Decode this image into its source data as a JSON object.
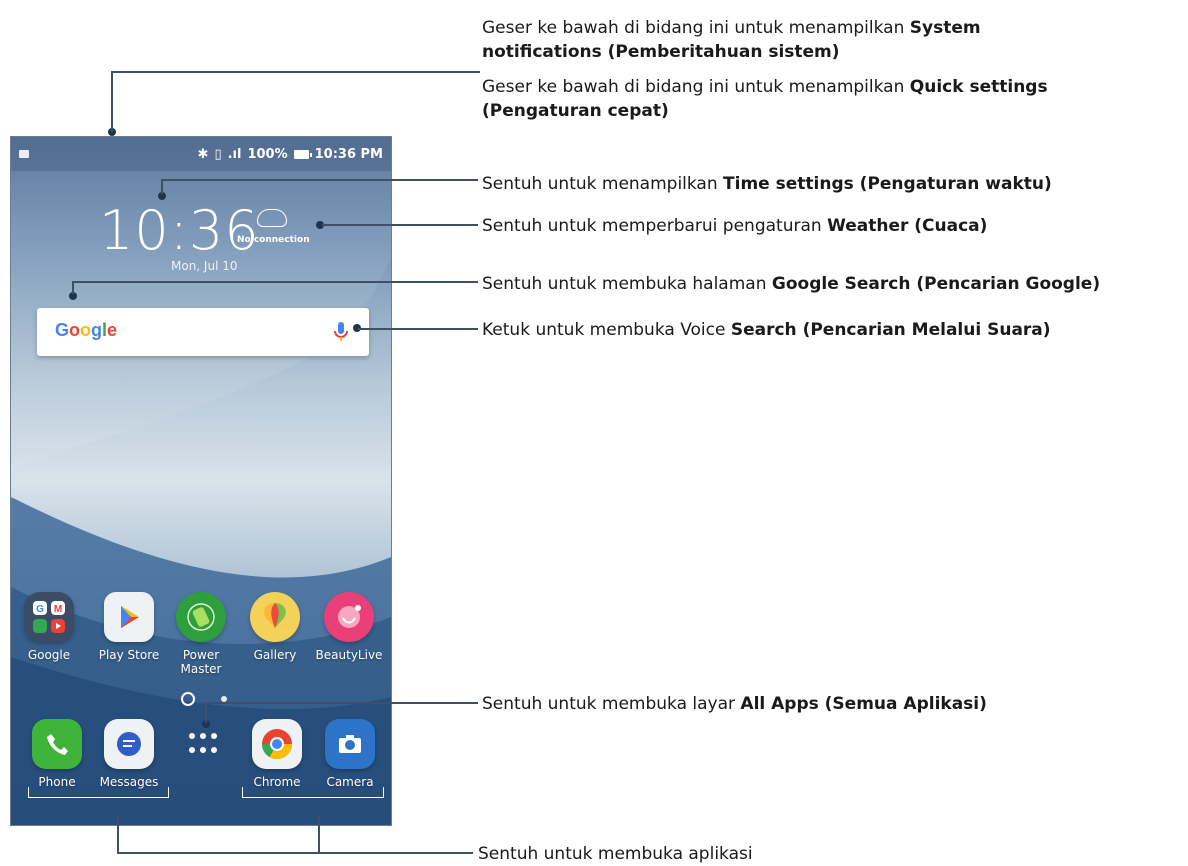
{
  "statusbar": {
    "signal": ".ıl",
    "battery": "100%",
    "time": "10:36 PM"
  },
  "clock": {
    "time": "10:36",
    "date": "Mon, Jul 10"
  },
  "weather": {
    "status": "No connection"
  },
  "search": {
    "logo": "Google"
  },
  "apps_row": [
    {
      "label": "Google"
    },
    {
      "label": "Play Store"
    },
    {
      "label": "Power Master"
    },
    {
      "label": "Gallery"
    },
    {
      "label": "BeautyLive"
    }
  ],
  "dock": [
    {
      "label": "Phone"
    },
    {
      "label": "Messages"
    },
    {
      "label": "Chrome"
    },
    {
      "label": "Camera"
    }
  ],
  "callouts": {
    "notifications_pre": "Geser ke bawah di bidang ini untuk menampilkan",
    "notifications_bold": "System notifications (Pemberitahuan sistem)",
    "quick_pre": "Geser ke bawah di bidang ini untuk menampilkan",
    "quick_bold": "Quick settings (Pengaturan cepat)",
    "time_pre": "Sentuh untuk menampilkan",
    "time_bold": "Time settings (Pengaturan waktu)",
    "weather_pre": "Sentuh untuk memperbarui pengaturan",
    "weather_bold": "Weather (Cuaca)",
    "google_pre": "Sentuh untuk membuka halaman",
    "google_bold": "Google Search (Pencarian Google)",
    "voice_pre": "Ketuk untuk membuka Voice",
    "voice_bold": "Search (Pencarian Melalui Suara)",
    "allapps_pre": "Sentuh untuk membuka layar",
    "allapps_bold": "All Apps (Semua Aplikasi)",
    "open_apps": "Sentuh untuk membuka aplikasi"
  },
  "colors": {
    "callout_line": "#3e5066",
    "google_blue": "#4285F4",
    "google_red": "#EA4335",
    "google_yellow": "#FBBC05",
    "google_green": "#34A853"
  }
}
